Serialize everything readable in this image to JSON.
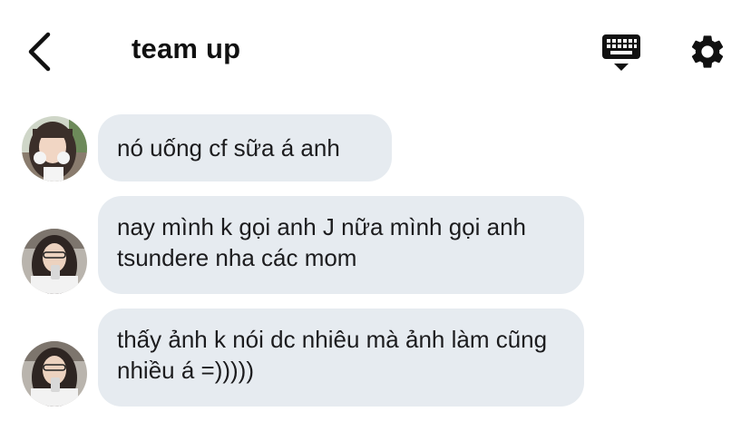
{
  "header": {
    "title": "team up",
    "icons": {
      "back": "back-chevron-icon",
      "keyboard": "keyboard-icon",
      "settings": "gear-icon"
    }
  },
  "messages": [
    {
      "text": "nó uống cf sữa á anh",
      "avatar": "avatar"
    },
    {
      "text": "nay mình k gọi anh J nữa mình gọi anh tsundere nha các mom",
      "avatar": "avatar"
    },
    {
      "text": "thấy ảnh k nói dc nhiêu mà ảnh làm cũng nhiều á =)))))",
      "avatar": "avatar"
    }
  ],
  "colors": {
    "bubble": "#e6ebf0",
    "text": "#1c1c1e",
    "title": "#111111"
  }
}
